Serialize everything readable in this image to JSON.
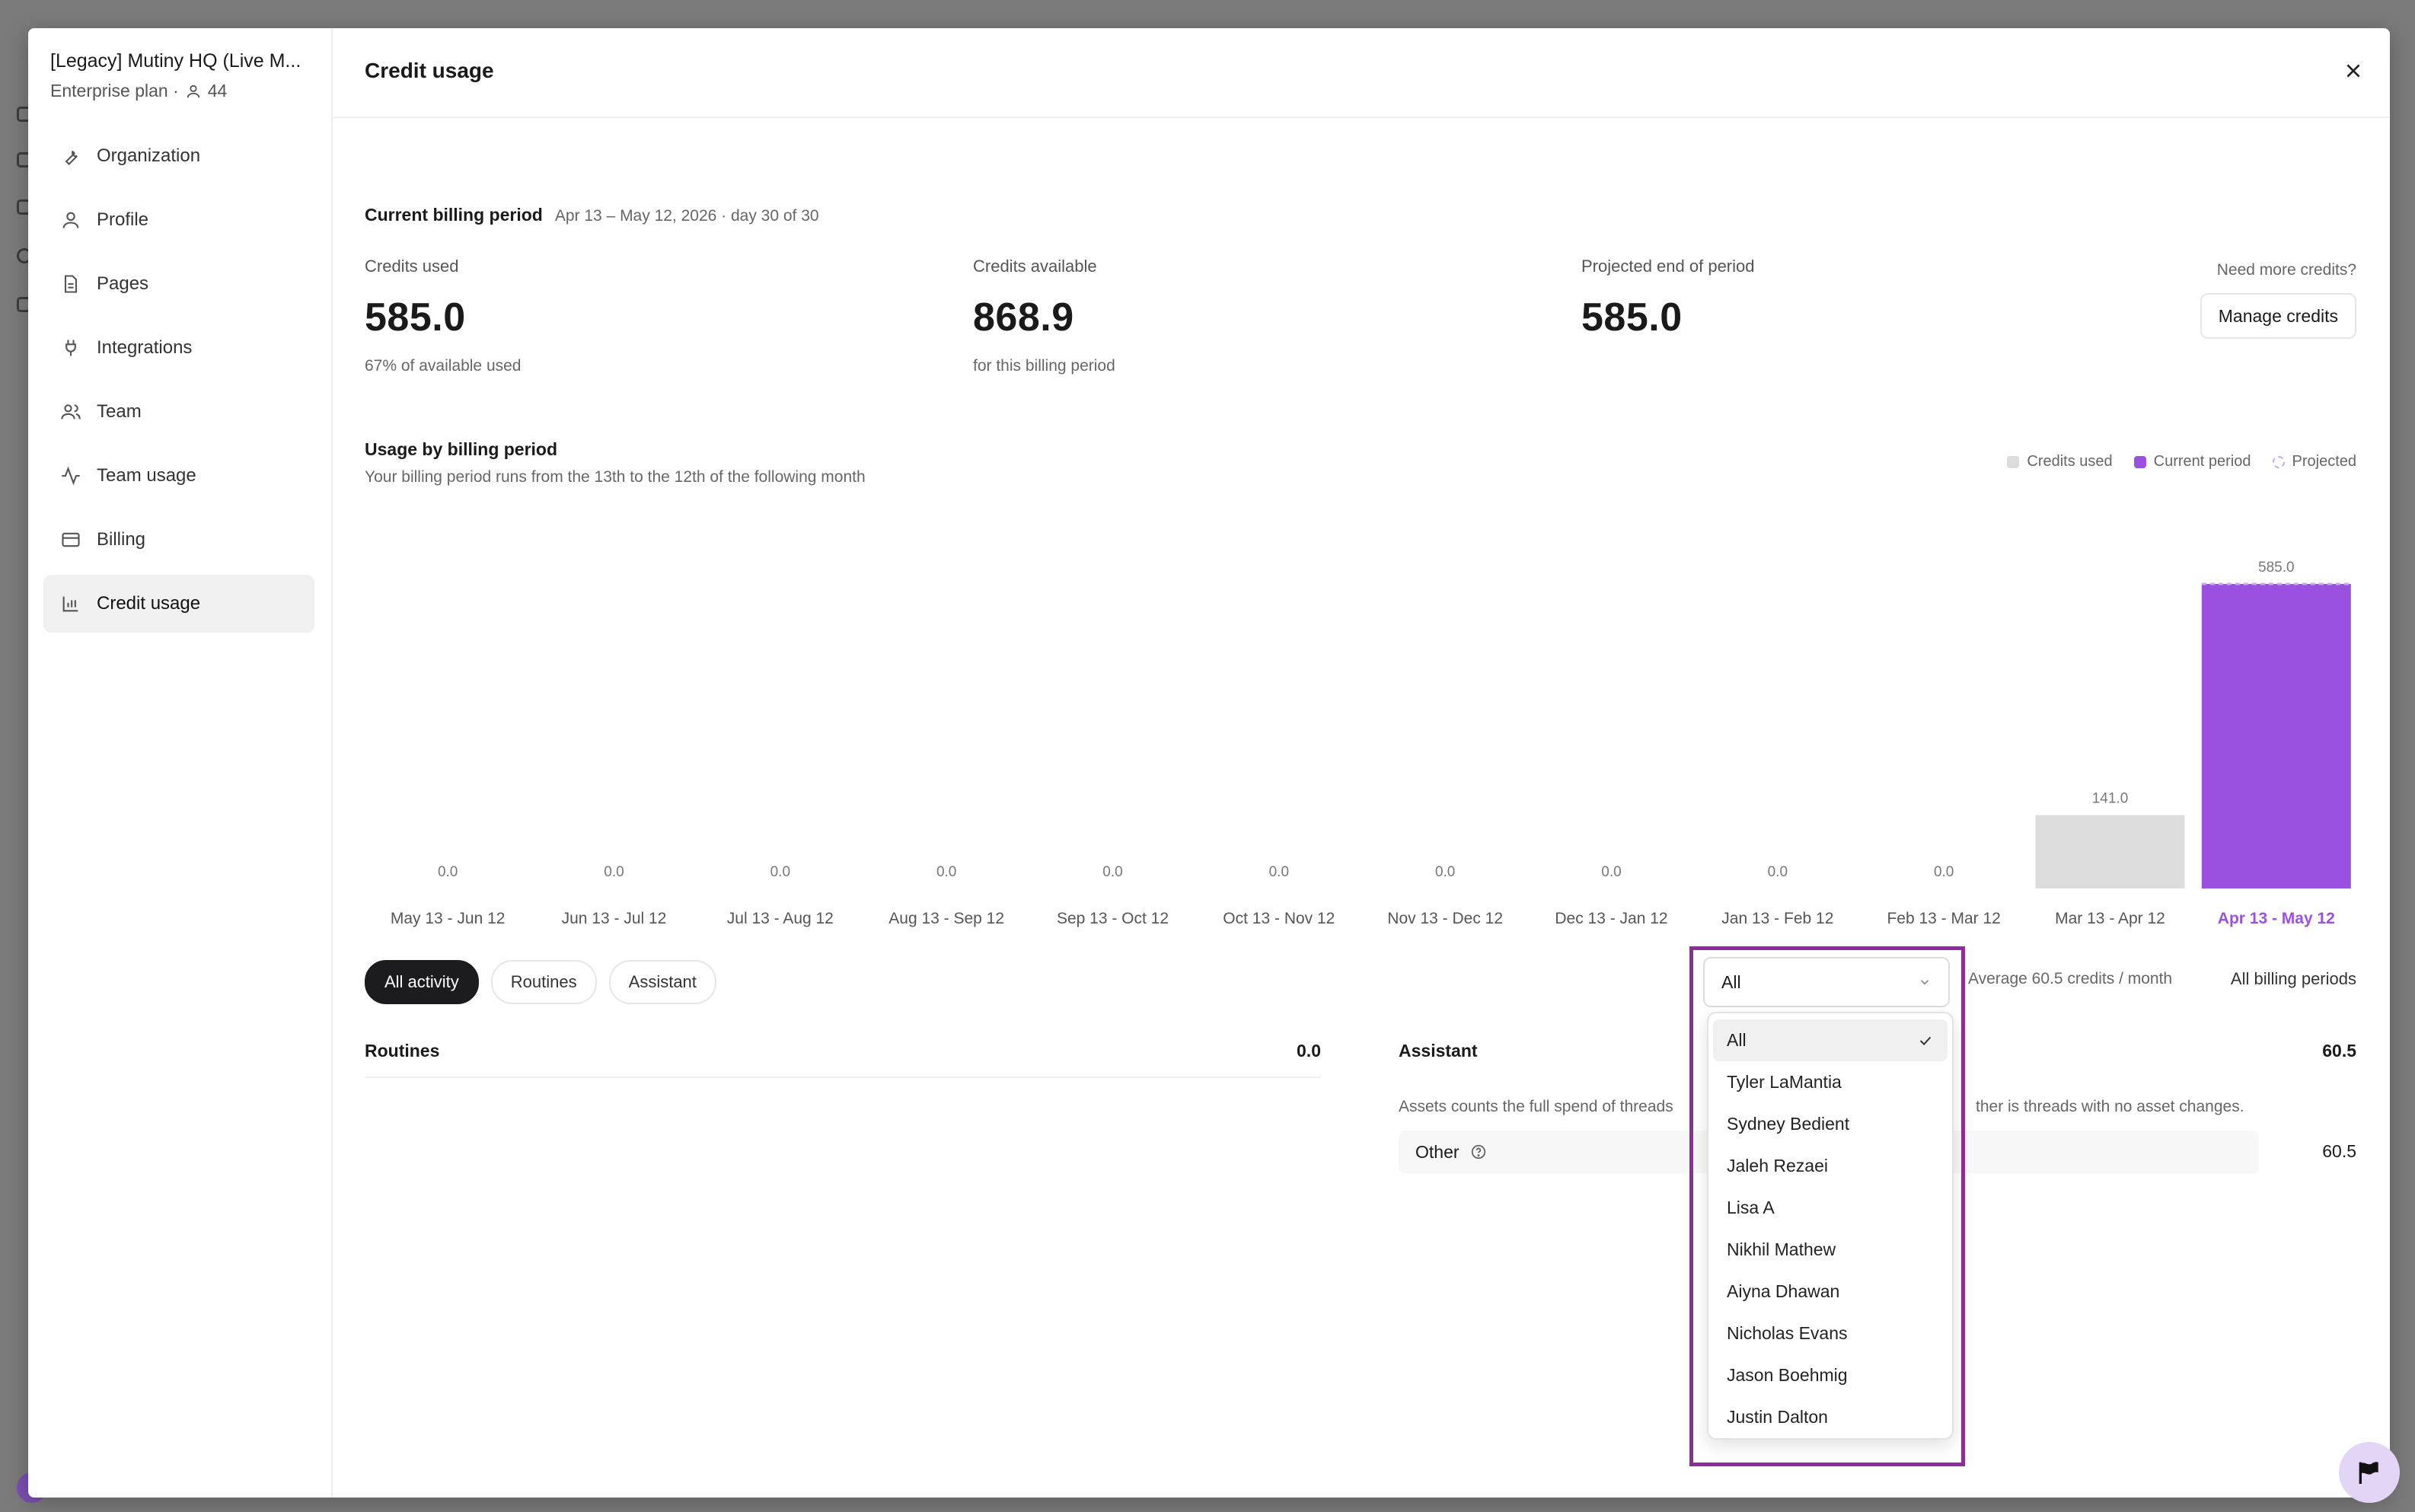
{
  "org": {
    "name": "[Legacy] Mutiny HQ (Live M...",
    "plan": "Enterprise plan ·",
    "members": "44"
  },
  "nav": [
    {
      "label": "Organization",
      "icon": "wrench-icon"
    },
    {
      "label": "Profile",
      "icon": "user-icon"
    },
    {
      "label": "Pages",
      "icon": "file-icon"
    },
    {
      "label": "Integrations",
      "icon": "plug-icon"
    },
    {
      "label": "Team",
      "icon": "users-icon"
    },
    {
      "label": "Team usage",
      "icon": "activity-icon"
    },
    {
      "label": "Billing",
      "icon": "credit-card-icon"
    },
    {
      "label": "Credit usage",
      "icon": "bar-chart-icon",
      "active": true
    }
  ],
  "header": {
    "title": "Credit usage"
  },
  "period": {
    "label": "Current billing period",
    "range": "Apr 13 – May 12, 2026 · day 30 of 30"
  },
  "stats": {
    "used": {
      "caption": "Credits used",
      "value": "585.0",
      "note": "67% of available used"
    },
    "available": {
      "caption": "Credits available",
      "value": "868.9",
      "note": "for this billing period"
    },
    "projected": {
      "caption": "Projected end of period",
      "value": "585.0"
    }
  },
  "more_credits": {
    "prompt": "Need more credits?",
    "button": "Manage credits"
  },
  "usage_chart": {
    "title": "Usage by billing period",
    "subtitle": "Your billing period runs from the 13th to the 12th of the following month",
    "legend": [
      "Credits used",
      "Current period",
      "Projected"
    ]
  },
  "colors": {
    "used": "#dcdcdc",
    "current": "#9b51e0",
    "projected": "#c9a8f0",
    "highlight": "#8e2c9c"
  },
  "chart_data": {
    "type": "bar",
    "categories": [
      "May 13 - Jun 12",
      "Jun 13 - Jul 12",
      "Jul 13 - Aug 12",
      "Aug 13 - Sep 12",
      "Sep 13 - Oct 12",
      "Oct 13 - Nov 12",
      "Nov 13 - Dec 12",
      "Dec 13 - Jan 12",
      "Jan 13 - Feb 12",
      "Feb 13 - Mar 12",
      "Mar 13 - Apr 12",
      "Apr 13 - May 12"
    ],
    "values": [
      0,
      0,
      0,
      0,
      0,
      0,
      0,
      0,
      0,
      0,
      141,
      585
    ],
    "value_labels": [
      "0.0",
      "0.0",
      "0.0",
      "0.0",
      "0.0",
      "0.0",
      "0.0",
      "0.0",
      "0.0",
      "0.0",
      "141.0",
      "585.0"
    ],
    "current_index": 11,
    "ylim": [
      0,
      585
    ],
    "grid": false,
    "legend_position": "top-right"
  },
  "tabs": [
    "All activity",
    "Routines",
    "Assistant"
  ],
  "filter": {
    "selected": "All",
    "average": "Average 60.5 credits / month",
    "periods": "All billing periods"
  },
  "routines": {
    "label": "Routines",
    "value": "0.0"
  },
  "assistant": {
    "label": "Assistant",
    "value": "60.5",
    "note_left": "Assets counts the full spend of threads",
    "note_right": "ther is threads with no asset changes.",
    "other_label": "Other",
    "other_value": "60.5"
  },
  "dropdown_options": [
    "All",
    "Tyler LaMantia",
    "Sydney Bedient",
    "Jaleh Rezaei",
    "Lisa A",
    "Nikhil Mathew",
    "Aiyna Dhawan",
    "Nicholas Evans",
    "Jason Boehmig",
    "Justin Dalton"
  ]
}
